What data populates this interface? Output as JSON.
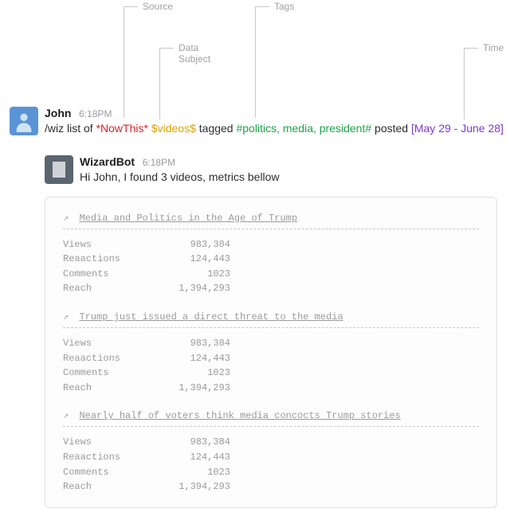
{
  "annotations": {
    "source": "Source",
    "data_subject": "Data\nSubject",
    "tags": "Tags",
    "time": "Time"
  },
  "user_message": {
    "name": "John",
    "time": "6:18PM",
    "cmd_prefix": "/wiz list of ",
    "source_token": "*NowThis*",
    "subject_token": "$videos$",
    "tagged_word": " tagged ",
    "tags_token": "#politics, media, president#",
    "posted_word": " posted ",
    "time_token": "[May 29 - June 28]"
  },
  "bot_message": {
    "name": "WizardBot",
    "time": "6:18PM",
    "text": "Hi John, I found 3 videos, metrics bellow"
  },
  "metric_labels": {
    "views": "Views",
    "reactions": "Reaactions",
    "comments": "Comments",
    "reach": "Reach"
  },
  "results": [
    {
      "title": "Media and Politics in the Age of Trump",
      "views": "983,384",
      "reactions": "124,443",
      "comments": "1023",
      "reach": "1,394,293"
    },
    {
      "title": "Trump just issued a direct threat to the media",
      "views": "983,384",
      "reactions": "124,443",
      "comments": "1023",
      "reach": "1,394,293"
    },
    {
      "title": "Nearly half of voters think media concocts Trump stories",
      "views": "983,384",
      "reactions": "124,443",
      "comments": "1023",
      "reach": "1,394,293"
    }
  ]
}
